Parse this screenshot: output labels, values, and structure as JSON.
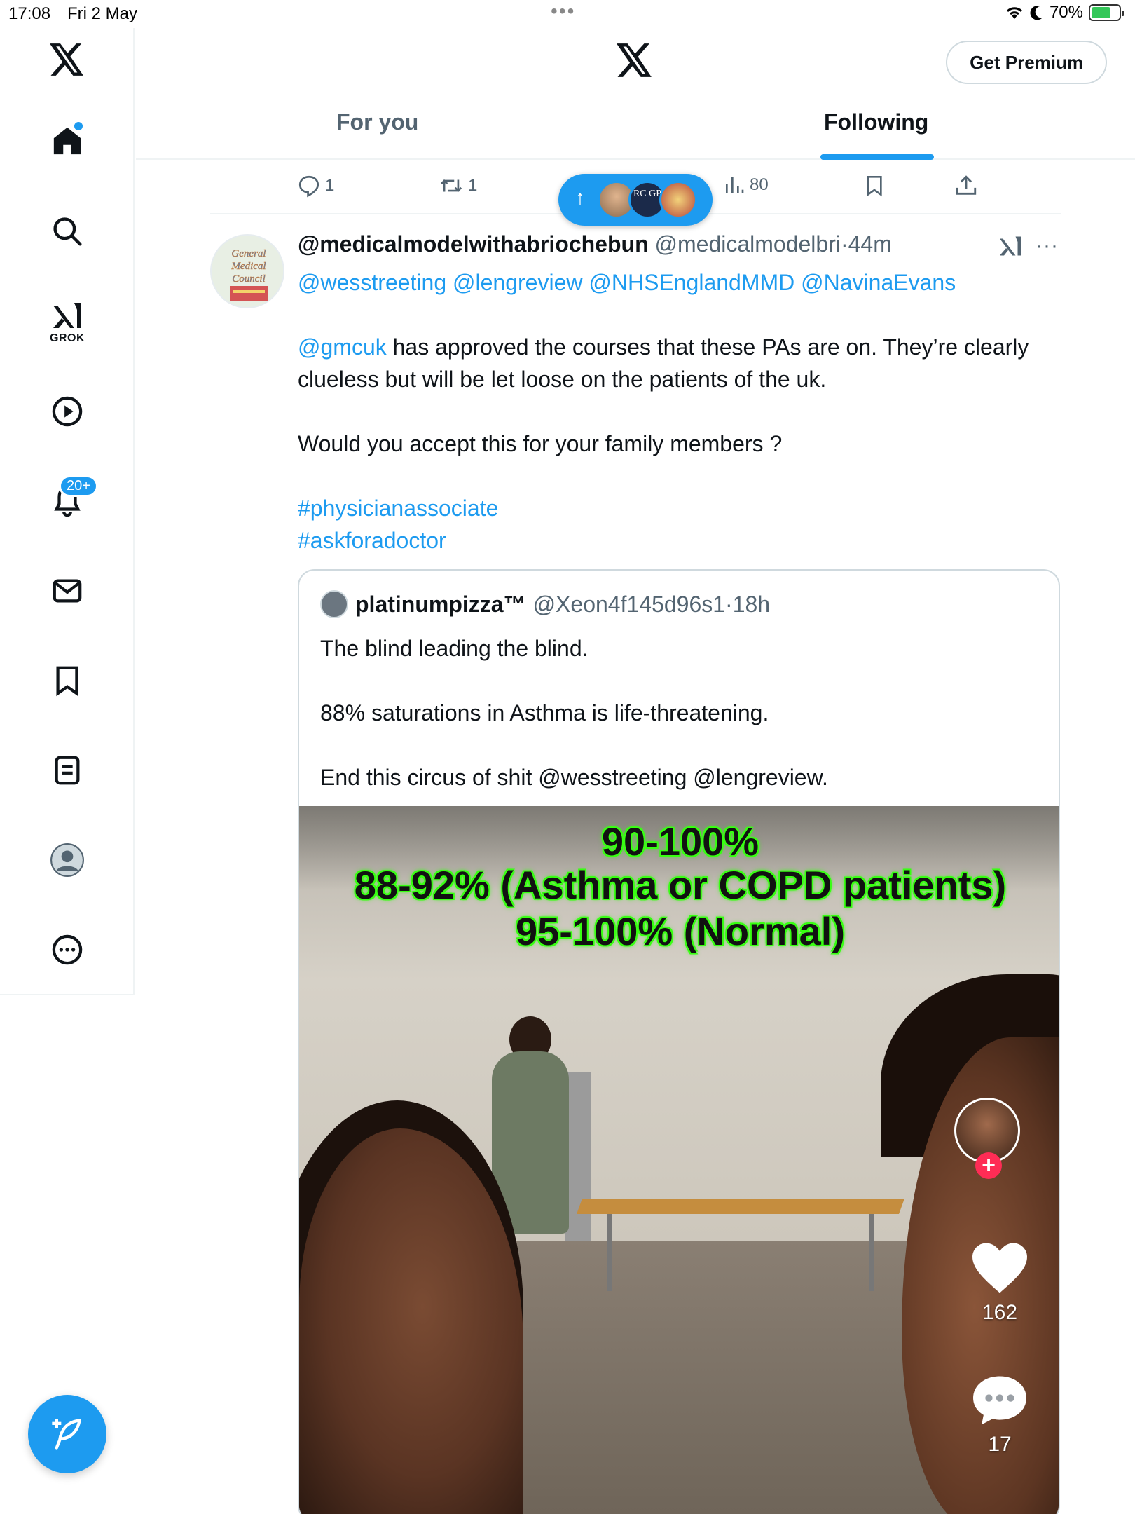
{
  "status_bar": {
    "time": "17:08",
    "date": "Fri 2 May",
    "battery": "70%",
    "battery_level": 0.7
  },
  "left_rail": {
    "grok_label": "GROK",
    "notifications_badge": "20+"
  },
  "header": {
    "premium_button": "Get Premium",
    "tabs": [
      {
        "label": "For you",
        "active": false
      },
      {
        "label": "Following",
        "active": true
      }
    ]
  },
  "previous_tweet_actions": {
    "replies": "1",
    "reposts": "1",
    "views": "80"
  },
  "tweet": {
    "display_name": "@medicalmodelwithabriochebun",
    "handle": "@medicalmodelbri",
    "separator": "·",
    "time": "44m",
    "mentions_line": "@wesstreeting @lengreview @NHSEnglandMMD @NavinaEvans",
    "para2_mention": "@gmcuk",
    "para2_text": " has approved the courses that these PAs are on. They’re clearly clueless but will be let loose on the patients of the uk.",
    "para3": "Would you accept this for your family members ?",
    "hashtag1": "#physicianassociate",
    "hashtag2": "#askforadoctor",
    "avatar_text": "General Medical Council"
  },
  "quote": {
    "display_name": "platinumpizza™",
    "handle": "@Xeon4f145d96s1",
    "separator": "·",
    "time": "18h",
    "line1": "The blind leading the blind.",
    "line2": "88% saturations in Asthma is life-threatening.",
    "line3": "End this circus of shit @wesstreeting @lengreview.",
    "media": {
      "overlay_line1": "90-100%",
      "overlay_line2": "88-92% (Asthma or COPD patients)",
      "overlay_line3": "95-100% (Normal)",
      "likes": "162",
      "comments": "17"
    }
  },
  "new_posts_pill": {
    "avatar_text": "RC GP"
  },
  "colors": {
    "accent": "#1d9bf0",
    "text_primary": "#0f1419",
    "text_secondary": "#536471",
    "border": "#cfd9de"
  }
}
